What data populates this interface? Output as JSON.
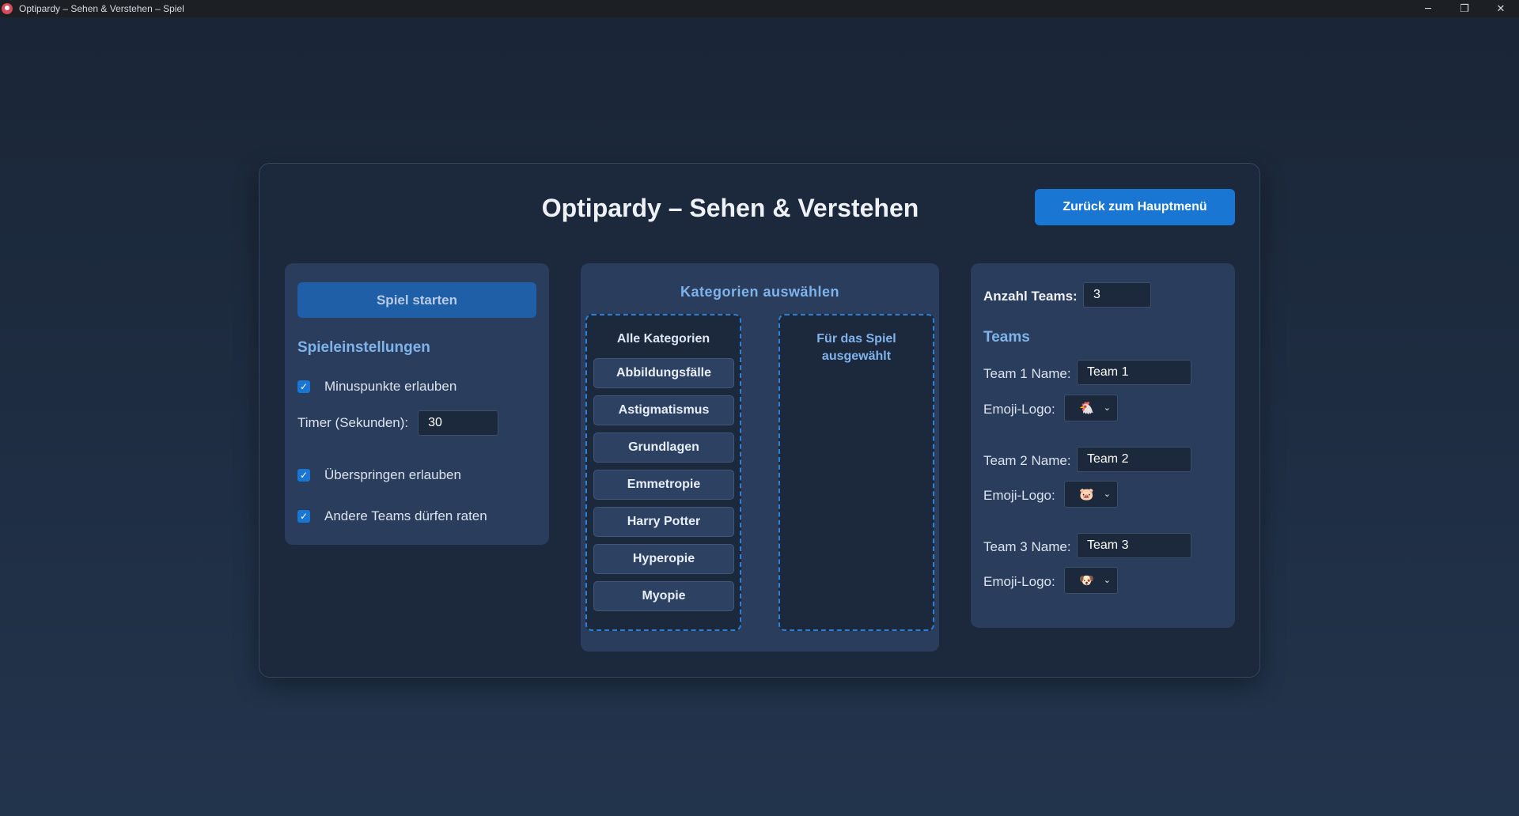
{
  "window": {
    "title": "Optipardy – Sehen & Verstehen – Spiel",
    "controls": {
      "minimize": "─",
      "restore": "❐",
      "close": "✕"
    }
  },
  "header": {
    "title": "Optipardy – Sehen & Verstehen",
    "back_button": "Zurück zum Hauptmenü"
  },
  "settings": {
    "start_button": "Spiel starten",
    "title": "Spieleinstellungen",
    "minus_points": {
      "label": "Minuspunkte erlauben",
      "checked": true
    },
    "timer": {
      "label": "Timer (Sekunden):",
      "value": "30"
    },
    "skip": {
      "label": "Überspringen erlauben",
      "checked": true
    },
    "others_guess": {
      "label": "Andere Teams dürfen raten",
      "checked": true
    },
    "check_mark": "✓"
  },
  "categories": {
    "title": "Kategorien auswählen",
    "all_title": "Alle Kategorien",
    "selected_title": "Für das Spiel ausgewählt",
    "items": [
      "Abbildungsfälle",
      "Astigmatismus",
      "Grundlagen",
      "Emmetropie",
      "Harry Potter",
      "Hyperopie",
      "Myopie"
    ]
  },
  "teams": {
    "count_label": "Anzahl Teams:",
    "count_value": "3",
    "title": "Teams",
    "emoji_label": "Emoji-Logo:",
    "chevron": "⌄",
    "list": [
      {
        "name_label": "Team 1 Name:",
        "name_value": "Team 1",
        "emoji": "🐔"
      },
      {
        "name_label": "Team 2 Name:",
        "name_value": "Team 2",
        "emoji": "🐷"
      },
      {
        "name_label": "Team 3 Name:",
        "name_value": "Team 3",
        "emoji": "🐶"
      }
    ]
  },
  "colors": {
    "accent": "#1976d2",
    "heading": "#7fb3ec",
    "panel": "#1c283b",
    "card": "#2a3d5c"
  }
}
